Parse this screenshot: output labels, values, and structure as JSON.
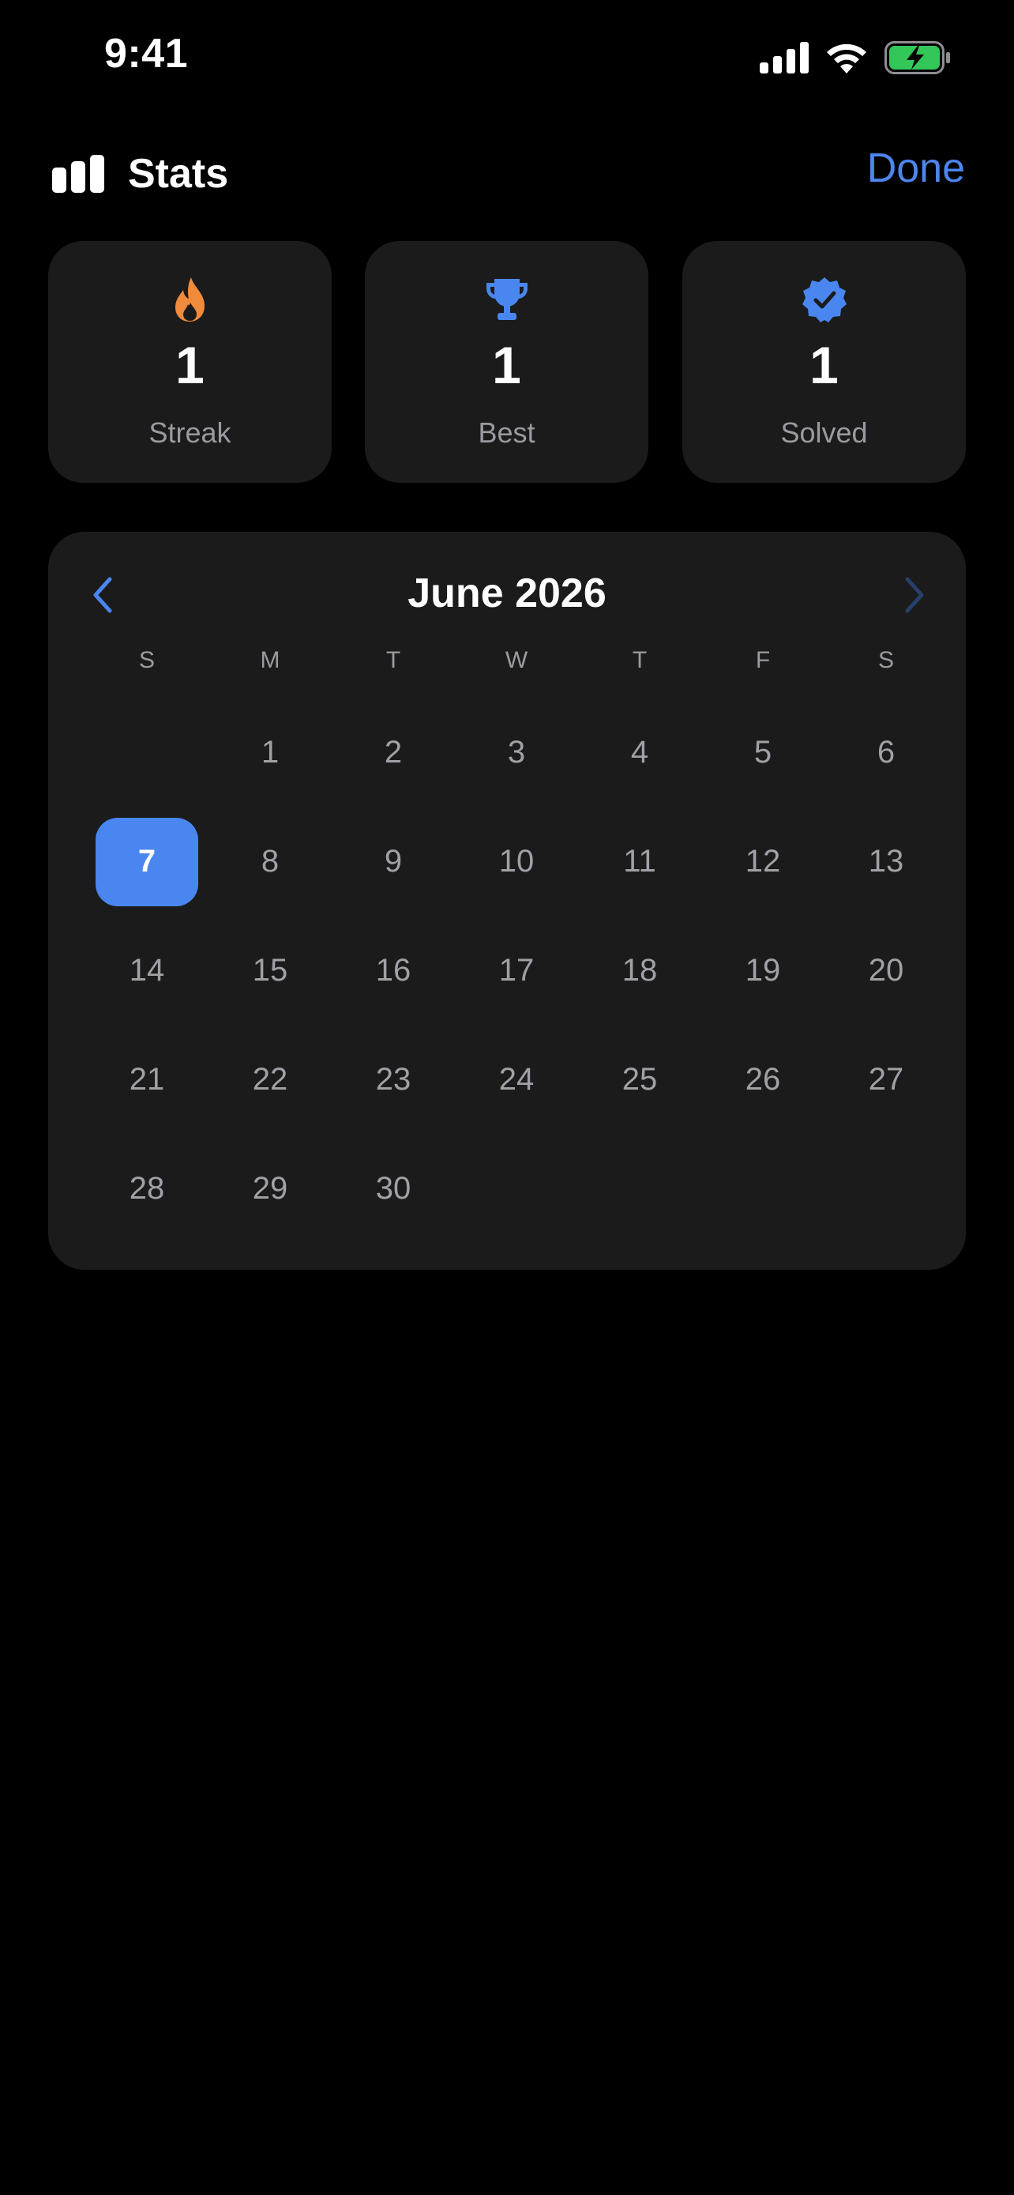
{
  "status_bar": {
    "time": "9:41",
    "icons": [
      "cellular-signal-icon",
      "wifi-icon",
      "battery-charging-icon"
    ]
  },
  "header": {
    "icon": "bar-chart-icon",
    "title": "Stats",
    "done_label": "Done"
  },
  "stats": [
    {
      "icon": "flame-icon",
      "value": "1",
      "label": "Streak",
      "color": "#f08a3c"
    },
    {
      "icon": "trophy-icon",
      "value": "1",
      "label": "Best",
      "color": "#4a86f0"
    },
    {
      "icon": "verified-badge-icon",
      "value": "1",
      "label": "Solved",
      "color": "#4a86f0"
    }
  ],
  "calendar": {
    "month_title": "June 2026",
    "weekdays": [
      "S",
      "M",
      "T",
      "W",
      "T",
      "F",
      "S"
    ],
    "leading_blanks": 1,
    "days": [
      "1",
      "2",
      "3",
      "4",
      "5",
      "6",
      "7",
      "8",
      "9",
      "10",
      "11",
      "12",
      "13",
      "14",
      "15",
      "16",
      "17",
      "18",
      "19",
      "20",
      "21",
      "22",
      "23",
      "24",
      "25",
      "26",
      "27",
      "28",
      "29",
      "30"
    ],
    "selected_day": "7",
    "prev_enabled": true,
    "next_enabled": false
  },
  "colors": {
    "accent": "#4a86f0",
    "card_bg": "#1b1b1b",
    "background": "#000000",
    "secondary_text": "#9a9aa0",
    "battery": "#33c759"
  }
}
